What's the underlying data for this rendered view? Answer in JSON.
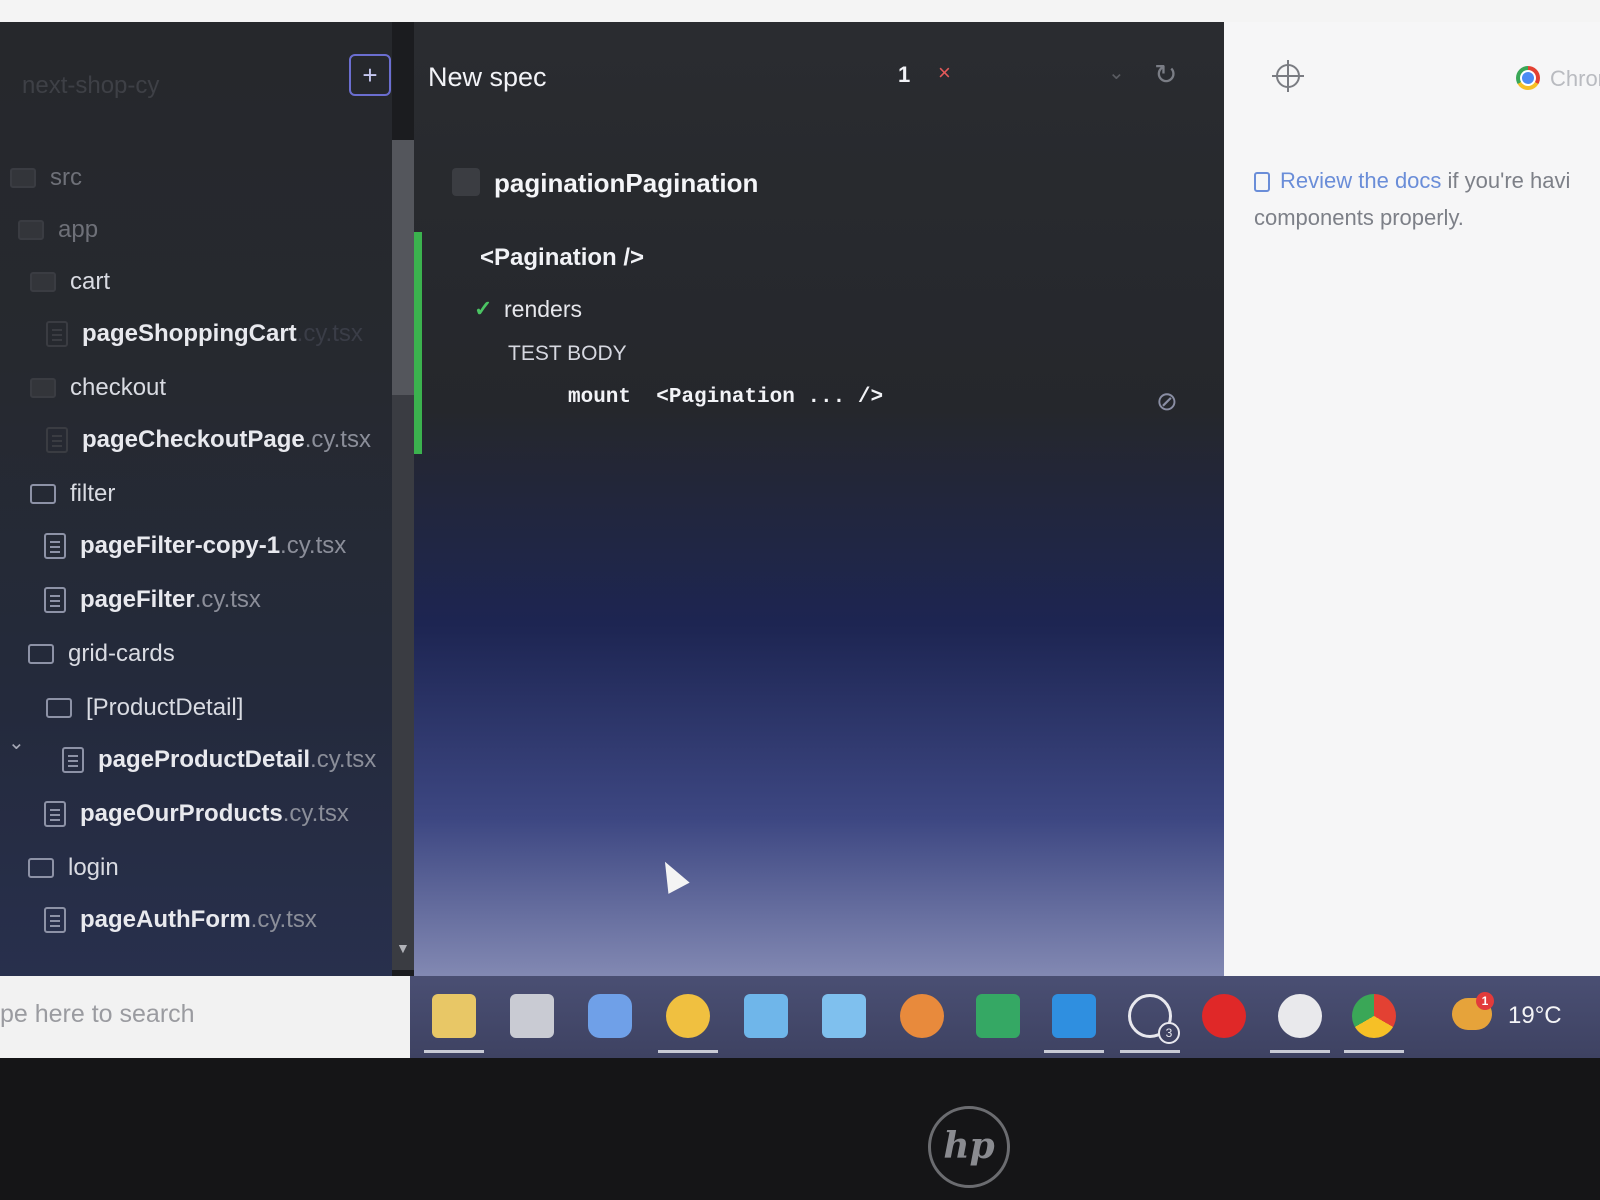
{
  "sidebar": {
    "project_name": "next-shop-cy",
    "add_label": "+",
    "items": [
      {
        "name": "src",
        "ext": ""
      },
      {
        "name": "app",
        "ext": ""
      },
      {
        "name": "cart",
        "ext": ""
      },
      {
        "name": "pageShoppingCart",
        "ext": ".cy.tsx"
      },
      {
        "name": "checkout",
        "ext": ""
      },
      {
        "name": "pageCheckoutPage",
        "ext": ".cy.tsx"
      },
      {
        "name": "filter",
        "ext": ""
      },
      {
        "name": "pageFilter-copy-1",
        "ext": ".cy.tsx"
      },
      {
        "name": "pageFilter",
        "ext": ".cy.tsx"
      },
      {
        "name": "grid-cards",
        "ext": ""
      },
      {
        "name": "[ProductDetail]",
        "ext": ""
      },
      {
        "name": "pageProductDetail",
        "ext": ".cy.tsx"
      },
      {
        "name": "pageOurProducts",
        "ext": ".cy.tsx"
      },
      {
        "name": "login",
        "ext": ""
      },
      {
        "name": "pageAuthForm",
        "ext": ".cy.tsx"
      }
    ]
  },
  "reporter": {
    "spec_title": "New spec",
    "pass_count": "1",
    "fail_count": "×",
    "suite_title": "paginationPagination",
    "describe": "<Pagination />",
    "test_name": "renders",
    "body_label": "TEST BODY",
    "command_name": "mount",
    "command_arg": "<Pagination ... />"
  },
  "right_panel": {
    "browser_label": "Chrome",
    "notice_link": "Review the docs",
    "notice_text": " if you're havi",
    "notice_line2": "components properly."
  },
  "taskbar": {
    "search_placeholder": "pe here to search",
    "temperature": "19°C",
    "whatsapp_badge": "3",
    "weather_badge": "1",
    "apps": [
      "file-explorer-icon",
      "tablet-icon",
      "copilot-icon",
      "chrome-canary-icon",
      "screens-icon",
      "mail-icon",
      "office-icon",
      "excel-icon",
      "vscode-icon",
      "whatsapp-icon",
      "record-icon",
      "cypress-icon",
      "chrome-icon"
    ]
  },
  "bezel": {
    "logo": "hp"
  },
  "colors": {
    "pass_green": "#3bb24e",
    "link_blue": "#6a8dd8",
    "fail_red": "#e45a5a"
  }
}
